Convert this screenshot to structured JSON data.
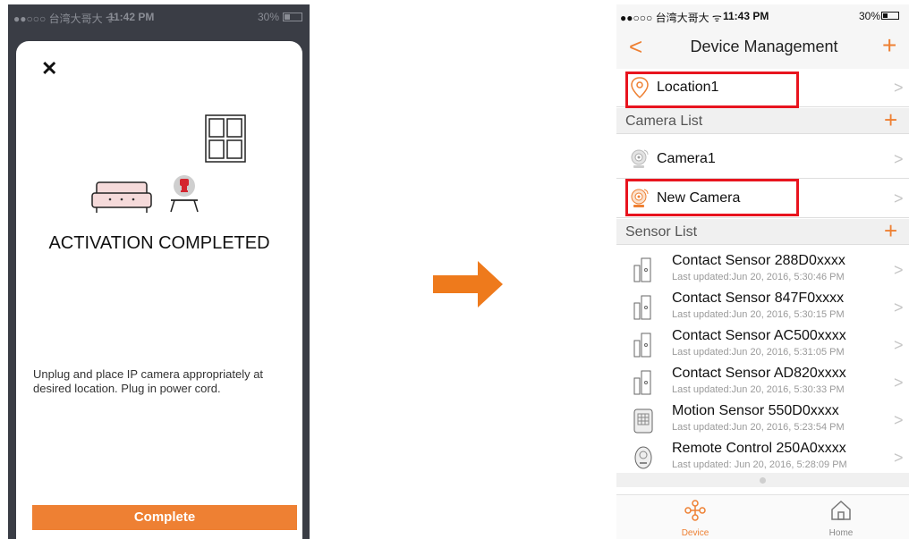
{
  "left_screen": {
    "status": {
      "carrier": "●●○○○ 台湾大哥大 ᯤ",
      "time": "11:42 PM",
      "battery": "30%"
    },
    "close_glyph": "✕",
    "title": "ACTIVATION COMPLETED",
    "message": "Unplug and place IP camera appropriately at desired location. Plug in power cord.",
    "complete_button": "Complete"
  },
  "right_screen": {
    "status": {
      "carrier": "●●○○○ 台湾大哥大 ᯤ",
      "time": "11:43 PM",
      "battery": "30%"
    },
    "nav": {
      "back_glyph": "<",
      "title": "Device Management",
      "add_glyph": "+"
    },
    "location": {
      "label": "Location1",
      "icon": "location-pin-icon"
    },
    "camera_section": {
      "label": "Camera List",
      "add_glyph": "+"
    },
    "cameras": [
      {
        "label": "Camera1",
        "icon": "camera-grey-icon"
      },
      {
        "label": "New Camera",
        "icon": "camera-orange-icon"
      }
    ],
    "sensor_section": {
      "label": "Sensor List",
      "add_glyph": "+"
    },
    "sensors": [
      {
        "name": "Contact Sensor 288D0xxxx",
        "updated": "Last updated:Jun 20, 2016, 5:30:46 PM",
        "icon": "contact-sensor-icon"
      },
      {
        "name": "Contact Sensor 847F0xxxx",
        "updated": "Last updated:Jun 20, 2016, 5:30:15 PM",
        "icon": "contact-sensor-icon"
      },
      {
        "name": "Contact Sensor AC500xxxx",
        "updated": "Last updated:Jun 20, 2016, 5:31:05 PM",
        "icon": "contact-sensor-icon"
      },
      {
        "name": "Contact Sensor AD820xxxx",
        "updated": "Last updated:Jun 20, 2016, 5:30:33 PM",
        "icon": "contact-sensor-icon"
      },
      {
        "name": "Motion Sensor 550D0xxxx",
        "updated": "Last updated:Jun 20, 2016, 5:23:54 PM",
        "icon": "motion-sensor-icon"
      },
      {
        "name": "Remote Control 250A0xxxx",
        "updated": "Last updated: Jun 20, 2016, 5:28:09 PM",
        "icon": "remote-control-icon"
      }
    ],
    "chevron_glyph": ">",
    "tabs": [
      {
        "label": "Device",
        "icon": "device-tree-icon",
        "active": true
      },
      {
        "label": "Home",
        "icon": "home-icon",
        "active": false
      }
    ]
  },
  "colors": {
    "accent": "#ee8033",
    "highlight": "#e8141e",
    "left_bg": "#3a3d45"
  }
}
